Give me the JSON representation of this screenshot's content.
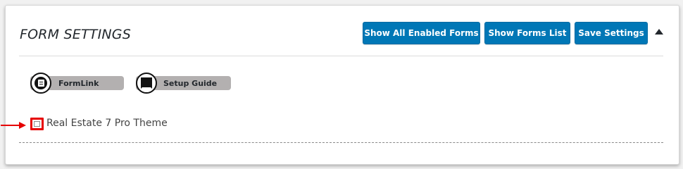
{
  "header": {
    "title": "FORM SETTINGS",
    "buttons": {
      "show_all_enabled": "Show All Enabled Forms",
      "show_forms_list": "Show Forms List",
      "save_settings": "Save Settings"
    },
    "collapse_icon": "triangle-up-icon"
  },
  "links": {
    "formlink": {
      "label": "FormLink",
      "icon": "document-icon"
    },
    "setup_guide": {
      "label": "Setup Guide",
      "icon": "guide-icon"
    }
  },
  "theme": {
    "label": "Real Estate 7 Pro Theme",
    "checked": false
  },
  "colors": {
    "button_blue": "#0077b6",
    "highlight_red": "#e60000",
    "pill_gray": "#b3b0b0"
  }
}
